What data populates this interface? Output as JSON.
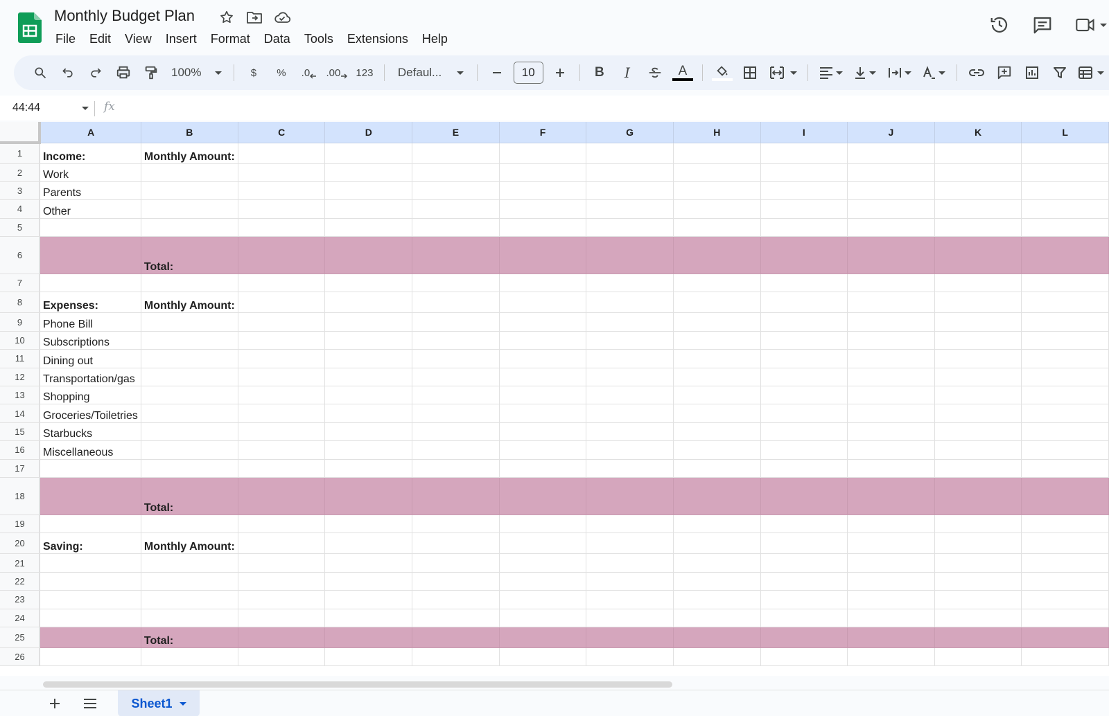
{
  "window": {
    "title": "Monthly Budget Plan"
  },
  "menu": [
    "File",
    "Edit",
    "View",
    "Insert",
    "Format",
    "Data",
    "Tools",
    "Extensions",
    "Help"
  ],
  "toolbar": {
    "zoom": "100%",
    "currency": "$",
    "percent": "%",
    "decrease_decimal": ".0",
    "increase_decimal": ".00",
    "number_format": "123",
    "font": "Defaul...",
    "font_size": "10",
    "bold": "B",
    "italic": "I",
    "text_color_letter": "A",
    "text_color": "#000000"
  },
  "formula_bar": {
    "name_box": "44:44",
    "fx": "fx"
  },
  "columns": [
    "A",
    "B",
    "C",
    "D",
    "E",
    "F",
    "G",
    "H",
    "I",
    "J",
    "K",
    "L"
  ],
  "rows": [
    {
      "n": "1",
      "a": "Income:",
      "b": "Monthly Amount:"
    },
    {
      "n": "2",
      "a": "Work",
      "b": ""
    },
    {
      "n": "3",
      "a": "Parents",
      "b": ""
    },
    {
      "n": "4",
      "a": "Other",
      "b": ""
    },
    {
      "n": "5",
      "a": "",
      "b": ""
    },
    {
      "n": "6",
      "a": "",
      "b": "Total:"
    },
    {
      "n": "7",
      "a": "",
      "b": ""
    },
    {
      "n": "8",
      "a": "Expenses:",
      "b": "Monthly Amount:"
    },
    {
      "n": "9",
      "a": "Phone Bill",
      "b": ""
    },
    {
      "n": "10",
      "a": "Subscriptions",
      "b": ""
    },
    {
      "n": "11",
      "a": "Dining out",
      "b": ""
    },
    {
      "n": "12",
      "a": "Transportation/gas",
      "b": ""
    },
    {
      "n": "13",
      "a": "Shopping",
      "b": ""
    },
    {
      "n": "14",
      "a": "Groceries/Toiletries",
      "b": ""
    },
    {
      "n": "15",
      "a": "Starbucks",
      "b": ""
    },
    {
      "n": "16",
      "a": "Miscellaneous",
      "b": ""
    },
    {
      "n": "17",
      "a": "",
      "b": ""
    },
    {
      "n": "18",
      "a": "",
      "b": "Total:"
    },
    {
      "n": "19",
      "a": "",
      "b": ""
    },
    {
      "n": "20",
      "a": "Saving:",
      "b": "Monthly Amount:"
    },
    {
      "n": "21",
      "a": "",
      "b": ""
    },
    {
      "n": "22",
      "a": "",
      "b": ""
    },
    {
      "n": "23",
      "a": "",
      "b": ""
    },
    {
      "n": "24",
      "a": "",
      "b": ""
    },
    {
      "n": "25",
      "a": "",
      "b": "Total:"
    },
    {
      "n": "26",
      "a": "",
      "b": ""
    }
  ],
  "colors": {
    "total_row_fill": "#d5a6bd",
    "header_fill": "#d3e3fd",
    "sheets_green": "#0f9d58",
    "accent_blue": "#0b57d0"
  },
  "sheet_tabs": [
    {
      "label": "Sheet1",
      "active": true
    }
  ]
}
